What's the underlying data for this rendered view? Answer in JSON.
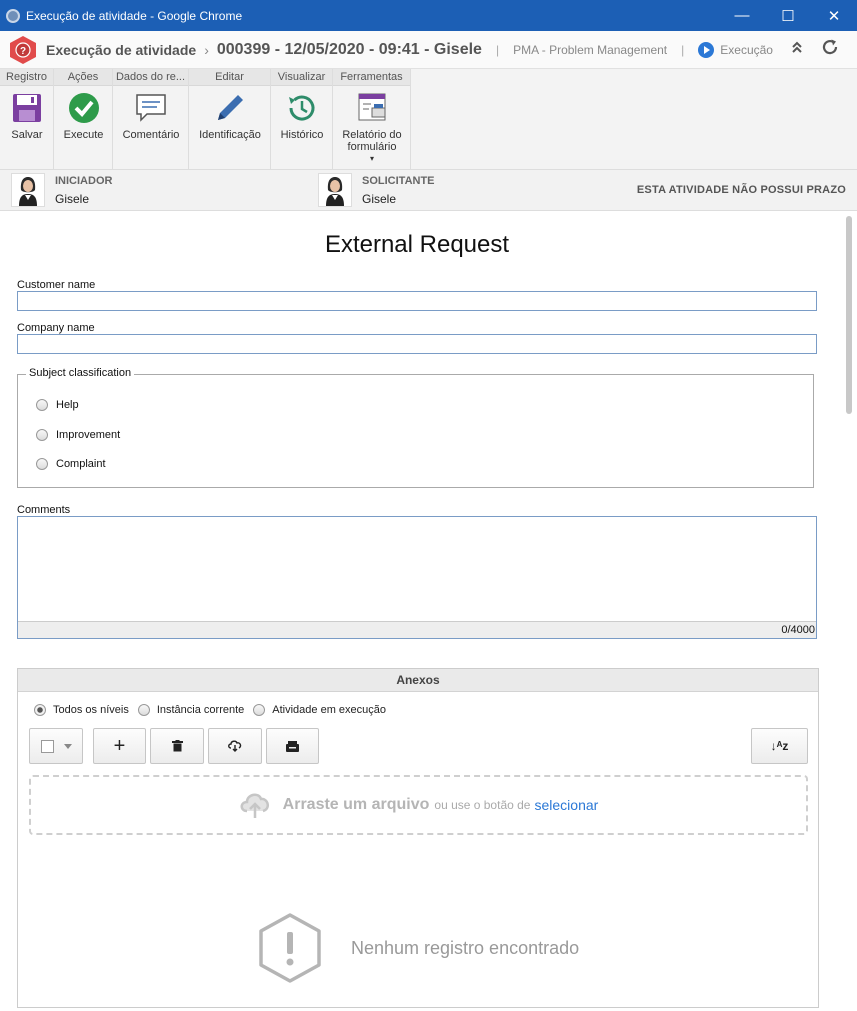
{
  "window": {
    "title": "Execução de atividade - Google Chrome",
    "controls": {
      "minimize": "—",
      "maximize": "☐",
      "close": "✕"
    }
  },
  "header": {
    "app_title": "Execução de atividade",
    "separator": "›",
    "record": "000399 - 12/05/2020 - 09:41 - Gisele",
    "process": "PMA - Problem Management",
    "status": "Execução",
    "pipe": "|",
    "collapse_icon": "⌃⌃",
    "refresh_icon": "⟳"
  },
  "ribbon": {
    "groups": [
      {
        "title": "Registro",
        "buttons": [
          {
            "label": "Salvar",
            "icon": "floppy-icon"
          }
        ]
      },
      {
        "title": "Ações",
        "buttons": [
          {
            "label": "Execute",
            "icon": "check-circle-icon"
          }
        ]
      },
      {
        "title": "Dados do re...",
        "buttons": [
          {
            "label": "Comentário",
            "icon": "comment-icon"
          }
        ]
      },
      {
        "title": "Editar",
        "buttons": [
          {
            "label": "Identificação",
            "icon": "pencil-icon"
          }
        ]
      },
      {
        "title": "Visualizar",
        "buttons": [
          {
            "label": "Histórico",
            "icon": "history-icon"
          }
        ]
      },
      {
        "title": "Ferramentas",
        "buttons": [
          {
            "label": "Relatório do formulário",
            "line1": "Relatório do",
            "line2": "formulário",
            "icon": "form-report-icon",
            "caret": "▾"
          }
        ]
      }
    ]
  },
  "participants": {
    "initiator": {
      "role": "INICIADOR",
      "name": "Gisele"
    },
    "requester": {
      "role": "SOLICITANTE",
      "name": "Gisele"
    },
    "deadline": "ESTA ATIVIDADE NÃO POSSUI PRAZO"
  },
  "form": {
    "title": "External Request",
    "customer_name": {
      "label": "Customer name",
      "value": ""
    },
    "company_name": {
      "label": "Company name",
      "value": ""
    },
    "subject": {
      "legend": "Subject classification",
      "options": [
        "Help",
        "Improvement",
        "Complaint"
      ]
    },
    "comments": {
      "label": "Comments",
      "value": "",
      "counter": "0/4000"
    }
  },
  "attachments": {
    "title": "Anexos",
    "levels": [
      "Todos os níveis",
      "Instância corrente",
      "Atividade em execução"
    ],
    "selected_level": "Todos os níveis",
    "add_icon": "+",
    "sort_icon": "↓ᴬᴢ",
    "drop_big": "Arraste um arquivo",
    "drop_small": "ou use o botão de",
    "drop_link": "selecionar",
    "empty_message": "Nenhum registro encontrado"
  },
  "colors": {
    "titlebar": "#1c5fb5",
    "accent": "#2b78d6",
    "input_border": "#7a9cc6",
    "brand_red": "#e14b4b"
  }
}
